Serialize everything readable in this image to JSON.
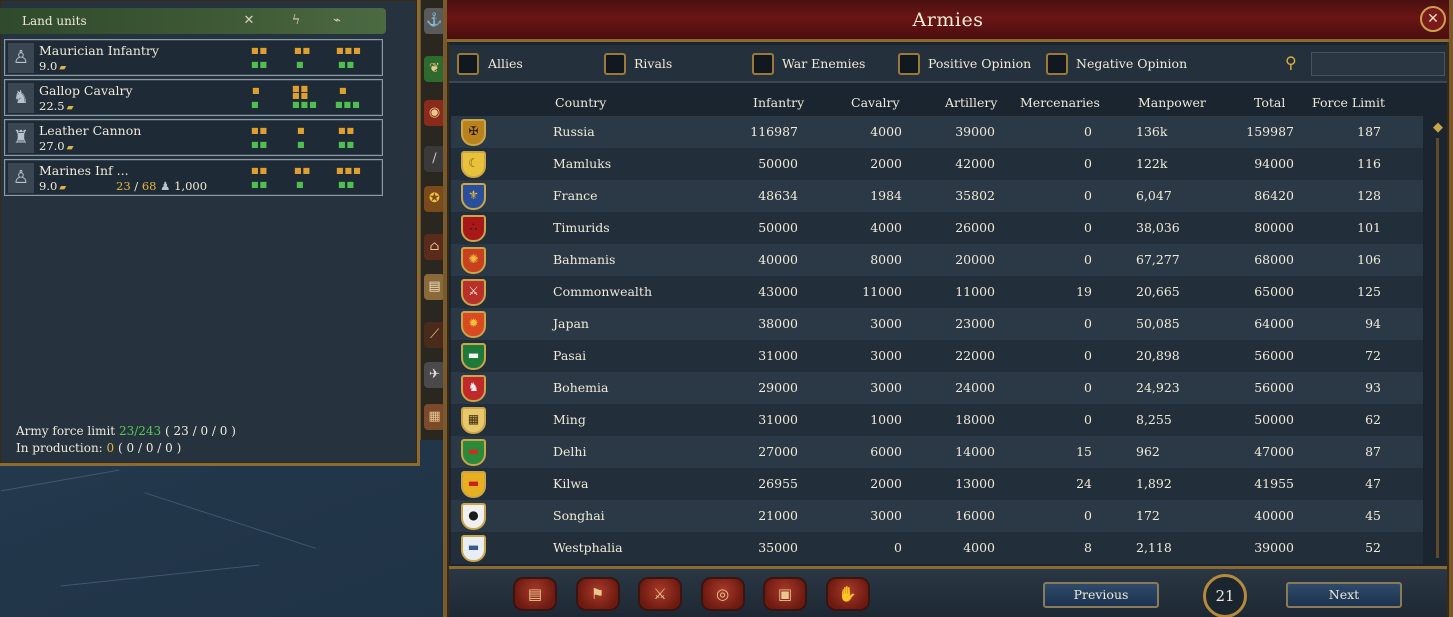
{
  "left_panel": {
    "title": "Land units",
    "header_icons": [
      "crossed-swords-icon",
      "lightning-icon",
      "horn-icon"
    ],
    "units": [
      {
        "name": "Maurician Infantry",
        "cost": "9.0",
        "icon": "infantry-icon"
      },
      {
        "name": "Gallop Cavalry",
        "cost": "22.5",
        "icon": "cavalry-icon"
      },
      {
        "name": "Leather Cannon",
        "cost": "27.0",
        "icon": "cannon-icon"
      },
      {
        "name": "Marines Inf ...",
        "cost": "9.0",
        "icon": "marines-icon",
        "extra_a": "23",
        "extra_sep": " / ",
        "extra_b": "68",
        "extra_c": "1,000"
      }
    ],
    "force_limit_label": "Army force limit",
    "force_limit_value": "23/243",
    "force_limit_breakdown": "( 23  / 0  / 0  )",
    "production_label": "In production:",
    "production_value": "0",
    "production_breakdown": "( 0  / 0  / 0  )"
  },
  "armies": {
    "title": "Armies",
    "filters": [
      "Allies",
      "Rivals",
      "War Enemies",
      "Positive Opinion",
      "Negative Opinion"
    ],
    "search_placeholder": "",
    "columns": {
      "country": "Country",
      "infantry": "Infantry",
      "cavalry": "Cavalry",
      "artillery": "Artillery",
      "mercenaries": "Mercenaries",
      "manpower": "Manpower",
      "total": "Total",
      "force_limit": "Force Limit"
    },
    "rows": [
      {
        "country": "Russia",
        "infantry": "116987",
        "cavalry": "4000",
        "artillery": "39000",
        "mercenaries": "0",
        "manpower": "136k",
        "total": "159987",
        "force_limit": "187",
        "flag": "#b8831c",
        "flag_glyph": "✠",
        "glyph_color": "#2a1a0a"
      },
      {
        "country": "Mamluks",
        "infantry": "50000",
        "cavalry": "2000",
        "artillery": "42000",
        "mercenaries": "0",
        "manpower": "122k",
        "total": "94000",
        "force_limit": "116",
        "flag": "#e8c23a",
        "flag_glyph": "☾",
        "glyph_color": "#7a5a10"
      },
      {
        "country": "France",
        "infantry": "48634",
        "cavalry": "1984",
        "artillery": "35802",
        "mercenaries": "0",
        "manpower": "6,047",
        "total": "86420",
        "force_limit": "128",
        "flag": "#2a4e9a",
        "flag_glyph": "⚜",
        "glyph_color": "#e8c23a"
      },
      {
        "country": "Timurids",
        "infantry": "50000",
        "cavalry": "4000",
        "artillery": "26000",
        "mercenaries": "0",
        "manpower": "38,036",
        "total": "80000",
        "force_limit": "101",
        "flag": "#a81818",
        "flag_glyph": "∴",
        "glyph_color": "#1a1a1a"
      },
      {
        "country": "Bahmanis",
        "infantry": "40000",
        "cavalry": "8000",
        "artillery": "20000",
        "mercenaries": "0",
        "manpower": "67,277",
        "total": "68000",
        "force_limit": "106",
        "flag": "#c8401e",
        "flag_glyph": "✺",
        "glyph_color": "#f0c040"
      },
      {
        "country": "Commonwealth",
        "infantry": "43000",
        "cavalry": "11000",
        "artillery": "11000",
        "mercenaries": "19",
        "manpower": "20,665",
        "total": "65000",
        "force_limit": "125",
        "flag": "#b83028",
        "flag_glyph": "⚔",
        "glyph_color": "#f0f0f0"
      },
      {
        "country": "Japan",
        "infantry": "38000",
        "cavalry": "3000",
        "artillery": "23000",
        "mercenaries": "0",
        "manpower": "50,085",
        "total": "64000",
        "force_limit": "94",
        "flag": "#d84a20",
        "flag_glyph": "✹",
        "glyph_color": "#f0c040"
      },
      {
        "country": "Pasai",
        "infantry": "31000",
        "cavalry": "3000",
        "artillery": "22000",
        "mercenaries": "0",
        "manpower": "20,898",
        "total": "56000",
        "force_limit": "72",
        "flag": "#1e7a3a",
        "flag_glyph": "▬",
        "glyph_color": "#f4f4f4"
      },
      {
        "country": "Bohemia",
        "infantry": "29000",
        "cavalry": "3000",
        "artillery": "24000",
        "mercenaries": "0",
        "manpower": "24,923",
        "total": "56000",
        "force_limit": "93",
        "flag": "#c0282a",
        "flag_glyph": "♞",
        "glyph_color": "#f4f4f4"
      },
      {
        "country": "Ming",
        "infantry": "31000",
        "cavalry": "1000",
        "artillery": "18000",
        "mercenaries": "0",
        "manpower": "8,255",
        "total": "50000",
        "force_limit": "62",
        "flag": "#e8c86a",
        "flag_glyph": "▦",
        "glyph_color": "#3a2a10"
      },
      {
        "country": "Delhi",
        "infantry": "27000",
        "cavalry": "6000",
        "artillery": "14000",
        "mercenaries": "15",
        "manpower": "962",
        "total": "47000",
        "force_limit": "87",
        "flag": "#2a8a3a",
        "flag_glyph": "▬",
        "glyph_color": "#c83020"
      },
      {
        "country": "Kilwa",
        "infantry": "26955",
        "cavalry": "2000",
        "artillery": "13000",
        "mercenaries": "24",
        "manpower": "1,892",
        "total": "41955",
        "force_limit": "47",
        "flag": "#e8b020",
        "flag_glyph": "▬",
        "glyph_color": "#c82020"
      },
      {
        "country": "Songhai",
        "infantry": "21000",
        "cavalry": "3000",
        "artillery": "16000",
        "mercenaries": "0",
        "manpower": "172",
        "total": "40000",
        "force_limit": "45",
        "flag": "#f0f0f0",
        "flag_glyph": "●",
        "glyph_color": "#1a1a1a"
      },
      {
        "country": "Westphalia",
        "infantry": "35000",
        "cavalry": "0",
        "artillery": "4000",
        "mercenaries": "8",
        "manpower": "2,118",
        "total": "39000",
        "force_limit": "52",
        "flag": "#e8eef4",
        "flag_glyph": "▬",
        "glyph_color": "#3a5a8a"
      }
    ],
    "bottom_buttons": [
      {
        "name": "ledger-button",
        "icon": "▤"
      },
      {
        "name": "flag-button",
        "icon": "⚑"
      },
      {
        "name": "military-button",
        "icon": "⚔"
      },
      {
        "name": "economy-button",
        "icon": "◎"
      },
      {
        "name": "trade-button",
        "icon": "▣"
      },
      {
        "name": "diplomacy-button",
        "icon": "✋"
      }
    ],
    "previous_label": "Previous",
    "next_label": "Next",
    "page": "21"
  }
}
